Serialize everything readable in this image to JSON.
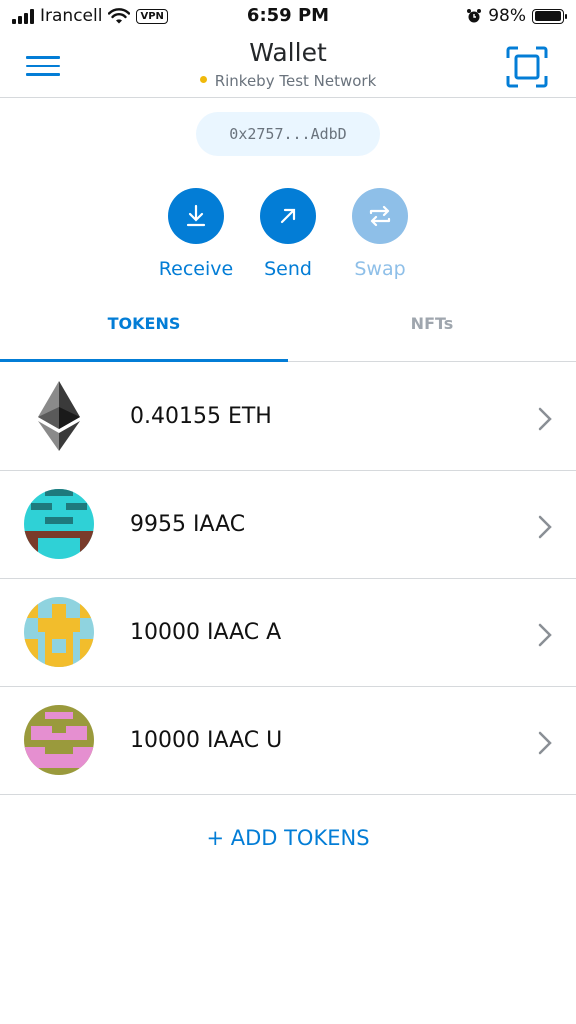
{
  "status_bar": {
    "carrier": "Irancell",
    "vpn": "VPN",
    "time": "6:59 PM",
    "battery": "98%",
    "battery_level": 0.98
  },
  "header": {
    "title": "Wallet",
    "network": "Rinkeby Test Network",
    "network_dot_color": "#f0b90b"
  },
  "account": {
    "address": "0x2757...AdbD"
  },
  "actions": [
    {
      "label": "Receive",
      "icon": "receive-icon",
      "enabled": true
    },
    {
      "label": "Send",
      "icon": "send-icon",
      "enabled": true
    },
    {
      "label": "Swap",
      "icon": "swap-icon",
      "enabled": false
    }
  ],
  "tabs": [
    {
      "label": "TOKENS",
      "active": true
    },
    {
      "label": "NFTs",
      "active": false
    }
  ],
  "tokens": [
    {
      "balance": "0.40155 ETH",
      "icon": "ethereum-logo"
    },
    {
      "balance": "9955 IAAC",
      "icon": "iaac-identicon"
    },
    {
      "balance": "10000 IAAC A",
      "icon": "iaac-a-identicon"
    },
    {
      "balance": "10000 IAAC U",
      "icon": "iaac-u-identicon"
    }
  ],
  "add_tokens": "+ ADD TOKENS",
  "colors": {
    "accent": "#037dd6",
    "accent_disabled": "#8ebfe8",
    "divider": "#d6d9dc"
  }
}
